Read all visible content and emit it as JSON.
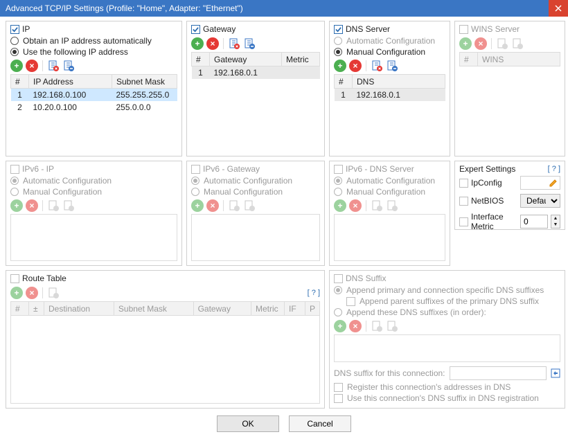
{
  "title": "Advanced TCP/IP Settings (Profile: \"Home\", Adapter: \"Ethernet\")",
  "panels": {
    "ip": {
      "title": "IP",
      "opt_auto": "Obtain an IP address automatically",
      "opt_manual": "Use the following IP address",
      "cols": {
        "num": "#",
        "addr": "IP Address",
        "mask": "Subnet Mask"
      },
      "rows": [
        {
          "n": "1",
          "addr": "192.168.0.100",
          "mask": "255.255.255.0"
        },
        {
          "n": "2",
          "addr": "10.20.0.100",
          "mask": "255.0.0.0"
        }
      ]
    },
    "gateway": {
      "title": "Gateway",
      "cols": {
        "num": "#",
        "gw": "Gateway",
        "metric": "Metric"
      },
      "rows": [
        {
          "n": "1",
          "gw": "192.168.0.1",
          "metric": ""
        }
      ]
    },
    "dns": {
      "title": "DNS Server",
      "opt_auto": "Automatic Configuration",
      "opt_manual": "Manual Configuration",
      "cols": {
        "num": "#",
        "dns": "DNS"
      },
      "rows": [
        {
          "n": "1",
          "dns": "192.168.0.1"
        }
      ]
    },
    "wins": {
      "title": "WINS Server",
      "cols": {
        "num": "#",
        "wins": "WINS"
      }
    },
    "ipv6_ip": {
      "title": "IPv6 - IP",
      "opt_auto": "Automatic Configuration",
      "opt_manual": "Manual Configuration"
    },
    "ipv6_gw": {
      "title": "IPv6 - Gateway",
      "opt_auto": "Automatic Configuration",
      "opt_manual": "Manual Configuration"
    },
    "ipv6_dns": {
      "title": "IPv6 - DNS Server",
      "opt_auto": "Automatic Configuration",
      "opt_manual": "Manual Configuration"
    },
    "expert": {
      "title": "Expert Settings",
      "help": "[ ? ]",
      "ipconfig": "IpConfig",
      "netbios": "NetBIOS",
      "netbios_val": "Default",
      "ifmetric": "Interface Metric",
      "ifmetric_val": "0"
    },
    "route": {
      "title": "Route Table",
      "help": "[ ? ]",
      "cols": {
        "num": "#",
        "pm": "±",
        "dest": "Destination",
        "mask": "Subnet Mask",
        "gw": "Gateway",
        "metric": "Metric",
        "if": "IF",
        "p": "P"
      }
    },
    "suffix": {
      "title": "DNS Suffix",
      "opt_primary": "Append primary and connection specific DNS suffixes",
      "opt_parent": "Append parent suffixes of the primary DNS suffix",
      "opt_these": "Append these DNS suffixes (in order):",
      "label_conn": "DNS suffix for this connection:",
      "chk_register": "Register this connection's addresses in DNS",
      "chk_usedns": "Use this connection's DNS suffix in DNS registration"
    }
  },
  "footer": {
    "ok": "OK",
    "cancel": "Cancel"
  }
}
